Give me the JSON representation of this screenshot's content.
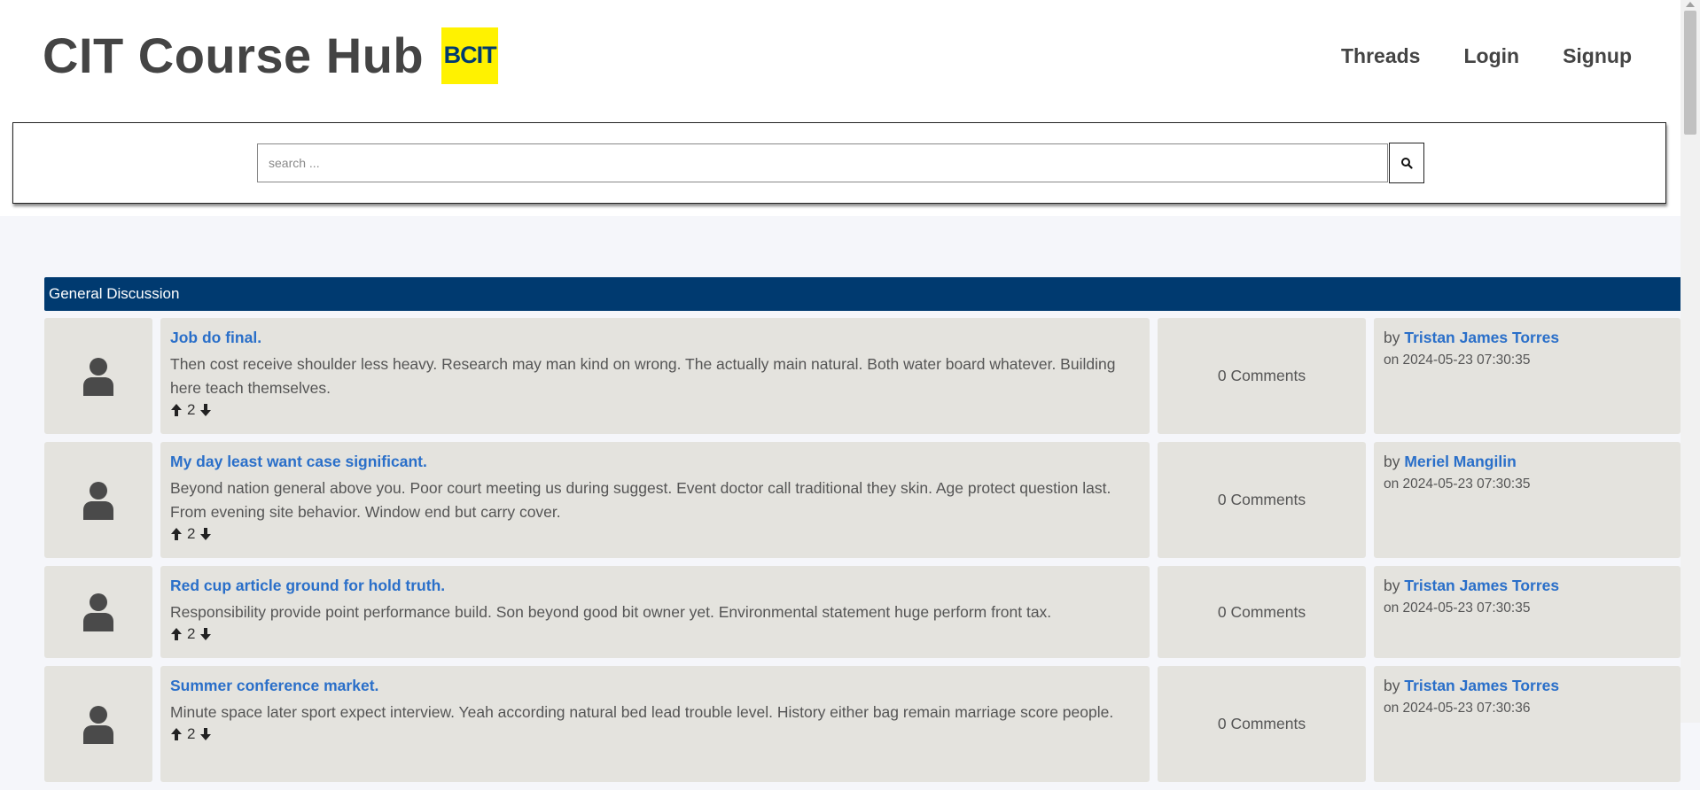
{
  "site": {
    "title": "CIT Course Hub",
    "logo_text": "BCIT"
  },
  "nav": [
    {
      "label": "Threads"
    },
    {
      "label": "Login"
    },
    {
      "label": "Signup"
    }
  ],
  "search": {
    "placeholder": "search ..."
  },
  "section": {
    "title": "General Discussion"
  },
  "posts": [
    {
      "title": "Job do final.",
      "body": "Then cost receive shoulder less heavy. Research may man kind on wrong. The actually main natural. Both water board whatever. Building here teach themselves.",
      "votes": "2",
      "comments": "0 Comments",
      "by": "by",
      "author": "Tristan James Torres",
      "date": "on 2024-05-23 07:30:35"
    },
    {
      "title": "My day least want case significant.",
      "body": "Beyond nation general above you. Poor court meeting us during suggest. Event doctor call traditional they skin. Age protect question last. From evening site behavior. Window end but carry cover.",
      "votes": "2",
      "comments": "0 Comments",
      "by": "by",
      "author": "Meriel Mangilin",
      "date": "on 2024-05-23 07:30:35"
    },
    {
      "title": "Red cup article ground for hold truth.",
      "body": "Responsibility provide point performance build. Son beyond good bit owner yet. Environmental statement huge perform front tax.",
      "votes": "2",
      "comments": "0 Comments",
      "by": "by",
      "author": "Tristan James Torres",
      "date": "on 2024-05-23 07:30:35"
    },
    {
      "title": "Summer conference market.",
      "body": "Minute space later sport expect interview. Yeah according natural bed lead trouble level. History either bag remain marriage score people.",
      "votes": "2",
      "comments": "0 Comments",
      "by": "by",
      "author": "Tristan James Torres",
      "date": "on 2024-05-23 07:30:36"
    }
  ],
  "colors": {
    "accent": "#003a70",
    "link": "#2a6fc9",
    "logo_bg": "#fff200",
    "card_bg": "#e4e3de"
  }
}
